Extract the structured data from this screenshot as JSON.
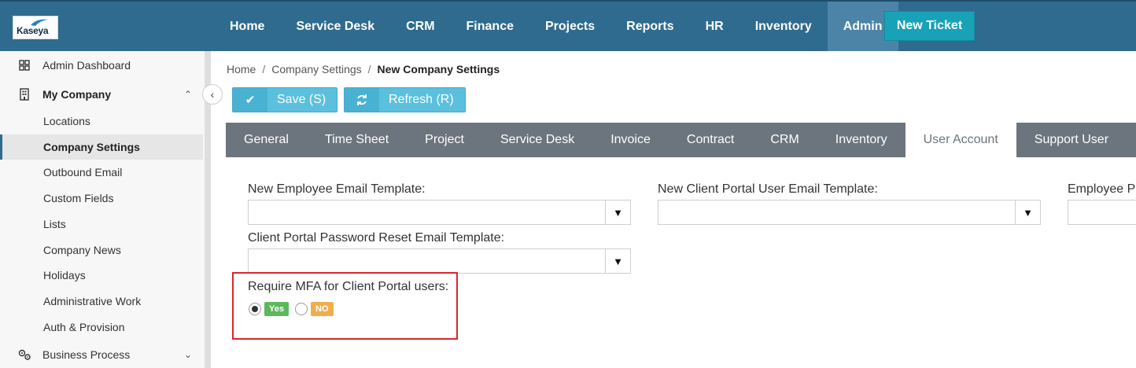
{
  "brand": {
    "logo_text": "Kaseya"
  },
  "colors": {
    "topbar": "#2f6b8e",
    "accent": "#17a2b8",
    "button": "#5bc0de",
    "tabs": "#6c757d",
    "highlight": "#d9262d",
    "yes": "#5cb85c",
    "no": "#f0ad4e"
  },
  "nav": {
    "items": [
      "Home",
      "Service Desk",
      "CRM",
      "Finance",
      "Projects",
      "Reports",
      "HR",
      "Inventory",
      "Admin"
    ],
    "active": "Admin",
    "new_ticket": "New Ticket"
  },
  "sidebar": {
    "admin_dashboard": {
      "label": "Admin Dashboard",
      "icon": "grid-icon"
    },
    "my_company": {
      "label": "My Company",
      "icon": "building-icon"
    },
    "sub": [
      "Locations",
      "Company Settings",
      "Outbound Email",
      "Custom Fields",
      "Lists",
      "Company News",
      "Holidays",
      "Administrative Work",
      "Auth & Provision"
    ],
    "selected": "Company Settings",
    "business_process": {
      "label": "Business Process",
      "icon": "gears-icon"
    }
  },
  "breadcrumb": {
    "home": "Home",
    "parent": "Company Settings",
    "current": "New Company Settings"
  },
  "toolbar": {
    "save": "Save (S)",
    "refresh": "Refresh (R)"
  },
  "tabs": {
    "items": [
      "General",
      "Time Sheet",
      "Project",
      "Service Desk",
      "Invoice",
      "Contract",
      "CRM",
      "Inventory",
      "User Account",
      "Support User"
    ],
    "active": "User Account"
  },
  "form": {
    "new_employee_email": {
      "label": "New Employee Email Template:",
      "value": ""
    },
    "new_client_portal_email": {
      "label": "New Client Portal User Email Template:",
      "value": ""
    },
    "employee_pa": {
      "label": "Employee Pa",
      "value": ""
    },
    "client_portal_reset": {
      "label": "Client Portal Password Reset Email Template:",
      "value": ""
    },
    "mfa": {
      "label": "Require MFA for Client Portal users:",
      "yes": "Yes",
      "no": "NO",
      "selected": "Yes"
    }
  }
}
